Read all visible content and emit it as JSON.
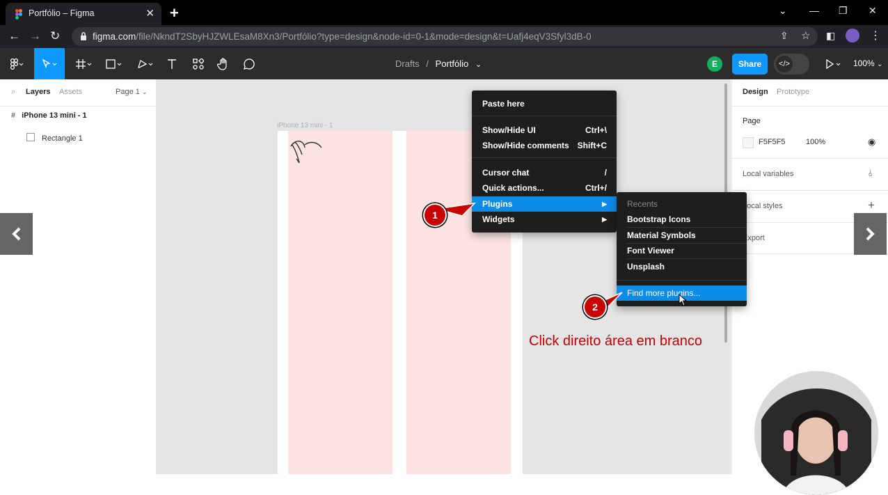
{
  "browser": {
    "tab_title": "Portfólio – Figma",
    "url_domain": "figma.com",
    "url_path": "/file/NkndT2SbyHJZWLEsaM8Xn3/Portfólio?type=design&node-id=0-1&mode=design&t=Uafj4eqV3Sfyl3dB-0"
  },
  "toolbar": {
    "breadcrumb_parent": "Drafts",
    "breadcrumb_separator": "/",
    "file_name": "Portfólio",
    "avatar_initial": "E",
    "share_label": "Share",
    "zoom_label": "100%"
  },
  "left_panel": {
    "tabs": [
      "Layers",
      "Assets"
    ],
    "page_selector": "Page 1",
    "layers": [
      {
        "name": "iPhone 13 mini - 1",
        "type": "frame"
      },
      {
        "name": "Rectangle 1",
        "type": "image"
      }
    ]
  },
  "canvas": {
    "frame_label": "iPhone 13 mini - 1"
  },
  "right_panel": {
    "tabs": [
      "Design",
      "Prototype"
    ],
    "page_section": "Page",
    "page_color": "F5F5F5",
    "page_opacity": "100%",
    "local_variables": "Local variables",
    "local_styles": "Local styles",
    "export": "Export"
  },
  "context_menu": {
    "items": [
      {
        "label": "Paste here",
        "shortcut": ""
      },
      {
        "label": "Show/Hide UI",
        "shortcut": "Ctrl+\\"
      },
      {
        "label": "Show/Hide comments",
        "shortcut": "Shift+C"
      },
      {
        "label": "Cursor chat",
        "shortcut": "/"
      },
      {
        "label": "Quick actions...",
        "shortcut": "Ctrl+/"
      },
      {
        "label": "Plugins",
        "shortcut": "▶"
      },
      {
        "label": "Widgets",
        "shortcut": "▶"
      }
    ]
  },
  "plugins_submenu": {
    "header": "Recents",
    "items": [
      "Bootstrap Icons",
      "Material Symbols",
      "Font Viewer",
      "Unsplash"
    ],
    "find_more": "Find more plugins..."
  },
  "annotations": {
    "badge_1": "1",
    "badge_2": "2",
    "caption": "Click direito área em branco"
  },
  "colors": {
    "figma_blue": "#0d99ff",
    "menu_highlight": "#0c8ce9",
    "frame_pink": "#fde4e2",
    "annotation_red": "#c80000"
  }
}
